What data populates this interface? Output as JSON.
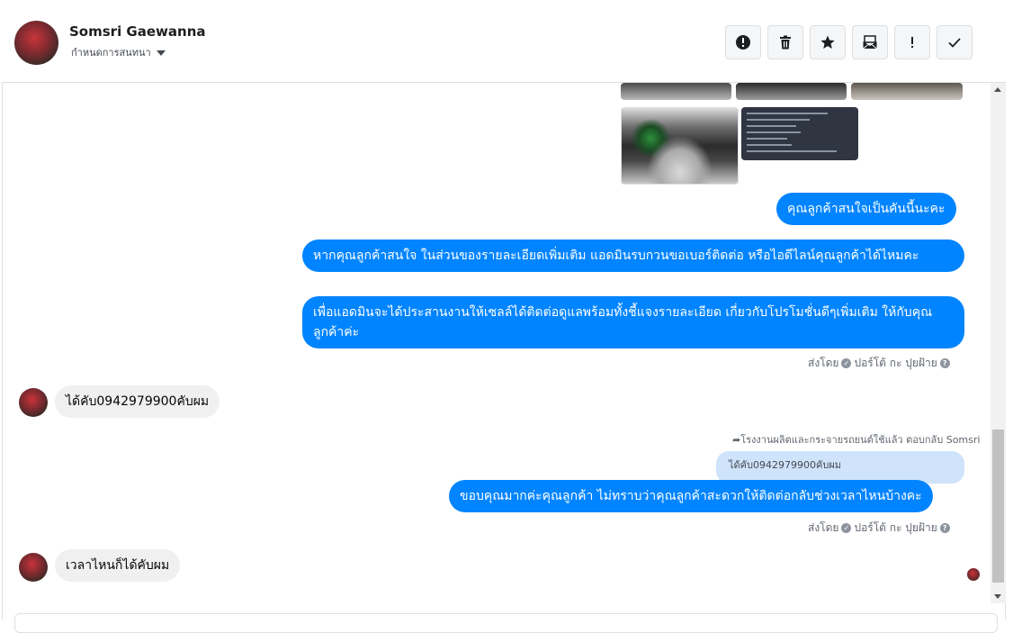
{
  "header": {
    "contact_name": "Somsri Gaewanna",
    "assign_label": "กำหนดการสนทนา",
    "actions": [
      {
        "name": "mark-spam-button",
        "icon": "alert-circle-icon"
      },
      {
        "name": "delete-button",
        "icon": "trash-icon"
      },
      {
        "name": "star-button",
        "icon": "star-icon"
      },
      {
        "name": "mark-unread-button",
        "icon": "envelope-icon"
      },
      {
        "name": "follow-up-button",
        "icon": "exclamation-icon"
      },
      {
        "name": "mark-done-button",
        "icon": "checkmark-icon"
      }
    ]
  },
  "thread": {
    "msg_customer_interest": "คุณลูกค้าสนใจเป็นคันนี้นะคะ",
    "msg_ask_contact": "หากคุณลูกค้าสนใจ ในส่วนของรายละเอียดเพิ่มเติม แอดมินรบกวนขอเบอร์ติดต่อ หรือไอดีไลน์คุณลูกค้าได้ไหมคะ",
    "msg_coordinate": "เพื่อแอดมินจะได้ประสานงานให้เซลล์ได้ติดต่อดูแลพร้อมทั้งชี้แจงรายละเอียด เกี่ยวกับโปรโมชั่นดีๆเพิ่มเติม ให้กับคุณลูกค้าค่ะ",
    "sent_by_1": "ส่งโดย",
    "sender_name_1": "ปอร์โต้ กะ ปุยฝ้าย",
    "msg_phone": "ได้คับ0942979900คับผม",
    "reply_meta": "โรงงานผลิตและกระจายรถยนต์ใช้แล้ว ตอบกลับ Somsri",
    "quoted_text": "ได้คับ0942979900คับผม",
    "msg_thanks": "ขอบคุณมากค่ะคุณลูกค้า ไม่ทราบว่าคุณลูกค้าสะดวกให้ติดต่อกลับช่วงเวลาไหนบ้างคะ",
    "sent_by_2": "ส่งโดย",
    "sender_name_2": "ปอร์โต้ กะ ปุยฝ้าย",
    "msg_anytime": "เวลาไหนก็ได้คับผม"
  },
  "colors": {
    "outgoing_bubble": "#0084ff",
    "incoming_bubble": "#f0f0f0",
    "quoted_bubble": "#cfe3fb"
  }
}
